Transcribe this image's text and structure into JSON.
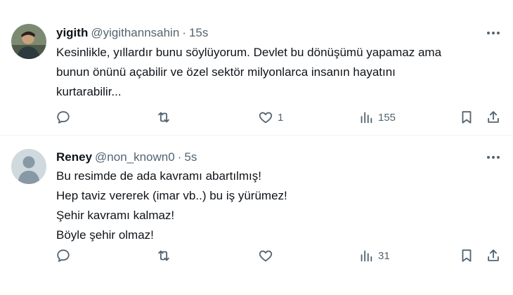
{
  "tweets": [
    {
      "display_name": "yigith",
      "handle": "@yigithannsahin",
      "separator": "·",
      "time": "15s",
      "avatar_icon": "user-photo-avatar",
      "text_lines": [
        "Kesinlikle, yıllardır bunu söylüyorum. Devlet bu dönüşümü yapamaz ama",
        "bunun önünü açabilir ve özel sektör milyonlarca insanın hayatını",
        "kurtarabilir..."
      ],
      "reply_count": "",
      "retweet_count": "",
      "like_count": "1",
      "view_count": "155"
    },
    {
      "display_name": "Reney",
      "handle": "@non_known0",
      "separator": "·",
      "time": "5s",
      "avatar_icon": "default-user-avatar",
      "text_lines": [
        "Bu resimde de ada kavramı abartılmış!",
        "Hep taviz vererek (imar vb..) bu iş yürümez!",
        "Şehir kavramı kalmaz!",
        "Böyle şehir olmaz!"
      ],
      "reply_count": "",
      "retweet_count": "",
      "like_count": "",
      "view_count": "31"
    }
  ],
  "colors": {
    "text_primary": "#0f1419",
    "text_secondary": "#536471",
    "divider": "#eff3f4",
    "default_avatar_bg": "#cfd9de",
    "default_avatar_fg": "#8899a6"
  }
}
